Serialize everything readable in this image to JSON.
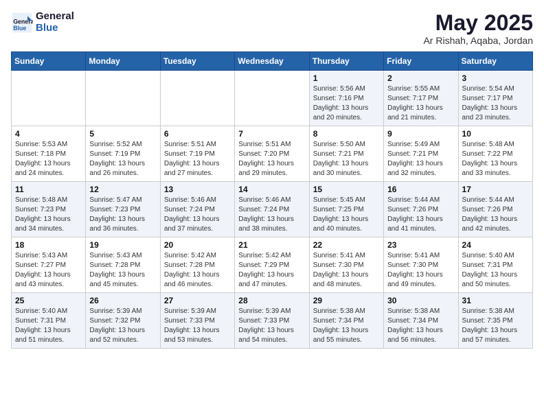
{
  "logo": {
    "line1": "General",
    "line2": "Blue"
  },
  "title": "May 2025",
  "subtitle": "Ar Rishah, Aqaba, Jordan",
  "days_of_week": [
    "Sunday",
    "Monday",
    "Tuesday",
    "Wednesday",
    "Thursday",
    "Friday",
    "Saturday"
  ],
  "weeks": [
    [
      {
        "num": "",
        "detail": ""
      },
      {
        "num": "",
        "detail": ""
      },
      {
        "num": "",
        "detail": ""
      },
      {
        "num": "",
        "detail": ""
      },
      {
        "num": "1",
        "detail": "Sunrise: 5:56 AM\nSunset: 7:16 PM\nDaylight: 13 hours and 20 minutes."
      },
      {
        "num": "2",
        "detail": "Sunrise: 5:55 AM\nSunset: 7:17 PM\nDaylight: 13 hours and 21 minutes."
      },
      {
        "num": "3",
        "detail": "Sunrise: 5:54 AM\nSunset: 7:17 PM\nDaylight: 13 hours and 23 minutes."
      }
    ],
    [
      {
        "num": "4",
        "detail": "Sunrise: 5:53 AM\nSunset: 7:18 PM\nDaylight: 13 hours and 24 minutes."
      },
      {
        "num": "5",
        "detail": "Sunrise: 5:52 AM\nSunset: 7:19 PM\nDaylight: 13 hours and 26 minutes."
      },
      {
        "num": "6",
        "detail": "Sunrise: 5:51 AM\nSunset: 7:19 PM\nDaylight: 13 hours and 27 minutes."
      },
      {
        "num": "7",
        "detail": "Sunrise: 5:51 AM\nSunset: 7:20 PM\nDaylight: 13 hours and 29 minutes."
      },
      {
        "num": "8",
        "detail": "Sunrise: 5:50 AM\nSunset: 7:21 PM\nDaylight: 13 hours and 30 minutes."
      },
      {
        "num": "9",
        "detail": "Sunrise: 5:49 AM\nSunset: 7:21 PM\nDaylight: 13 hours and 32 minutes."
      },
      {
        "num": "10",
        "detail": "Sunrise: 5:48 AM\nSunset: 7:22 PM\nDaylight: 13 hours and 33 minutes."
      }
    ],
    [
      {
        "num": "11",
        "detail": "Sunrise: 5:48 AM\nSunset: 7:23 PM\nDaylight: 13 hours and 34 minutes."
      },
      {
        "num": "12",
        "detail": "Sunrise: 5:47 AM\nSunset: 7:23 PM\nDaylight: 13 hours and 36 minutes."
      },
      {
        "num": "13",
        "detail": "Sunrise: 5:46 AM\nSunset: 7:24 PM\nDaylight: 13 hours and 37 minutes."
      },
      {
        "num": "14",
        "detail": "Sunrise: 5:46 AM\nSunset: 7:24 PM\nDaylight: 13 hours and 38 minutes."
      },
      {
        "num": "15",
        "detail": "Sunrise: 5:45 AM\nSunset: 7:25 PM\nDaylight: 13 hours and 40 minutes."
      },
      {
        "num": "16",
        "detail": "Sunrise: 5:44 AM\nSunset: 7:26 PM\nDaylight: 13 hours and 41 minutes."
      },
      {
        "num": "17",
        "detail": "Sunrise: 5:44 AM\nSunset: 7:26 PM\nDaylight: 13 hours and 42 minutes."
      }
    ],
    [
      {
        "num": "18",
        "detail": "Sunrise: 5:43 AM\nSunset: 7:27 PM\nDaylight: 13 hours and 43 minutes."
      },
      {
        "num": "19",
        "detail": "Sunrise: 5:43 AM\nSunset: 7:28 PM\nDaylight: 13 hours and 45 minutes."
      },
      {
        "num": "20",
        "detail": "Sunrise: 5:42 AM\nSunset: 7:28 PM\nDaylight: 13 hours and 46 minutes."
      },
      {
        "num": "21",
        "detail": "Sunrise: 5:42 AM\nSunset: 7:29 PM\nDaylight: 13 hours and 47 minutes."
      },
      {
        "num": "22",
        "detail": "Sunrise: 5:41 AM\nSunset: 7:30 PM\nDaylight: 13 hours and 48 minutes."
      },
      {
        "num": "23",
        "detail": "Sunrise: 5:41 AM\nSunset: 7:30 PM\nDaylight: 13 hours and 49 minutes."
      },
      {
        "num": "24",
        "detail": "Sunrise: 5:40 AM\nSunset: 7:31 PM\nDaylight: 13 hours and 50 minutes."
      }
    ],
    [
      {
        "num": "25",
        "detail": "Sunrise: 5:40 AM\nSunset: 7:31 PM\nDaylight: 13 hours and 51 minutes."
      },
      {
        "num": "26",
        "detail": "Sunrise: 5:39 AM\nSunset: 7:32 PM\nDaylight: 13 hours and 52 minutes."
      },
      {
        "num": "27",
        "detail": "Sunrise: 5:39 AM\nSunset: 7:33 PM\nDaylight: 13 hours and 53 minutes."
      },
      {
        "num": "28",
        "detail": "Sunrise: 5:39 AM\nSunset: 7:33 PM\nDaylight: 13 hours and 54 minutes."
      },
      {
        "num": "29",
        "detail": "Sunrise: 5:38 AM\nSunset: 7:34 PM\nDaylight: 13 hours and 55 minutes."
      },
      {
        "num": "30",
        "detail": "Sunrise: 5:38 AM\nSunset: 7:34 PM\nDaylight: 13 hours and 56 minutes."
      },
      {
        "num": "31",
        "detail": "Sunrise: 5:38 AM\nSunset: 7:35 PM\nDaylight: 13 hours and 57 minutes."
      }
    ]
  ]
}
